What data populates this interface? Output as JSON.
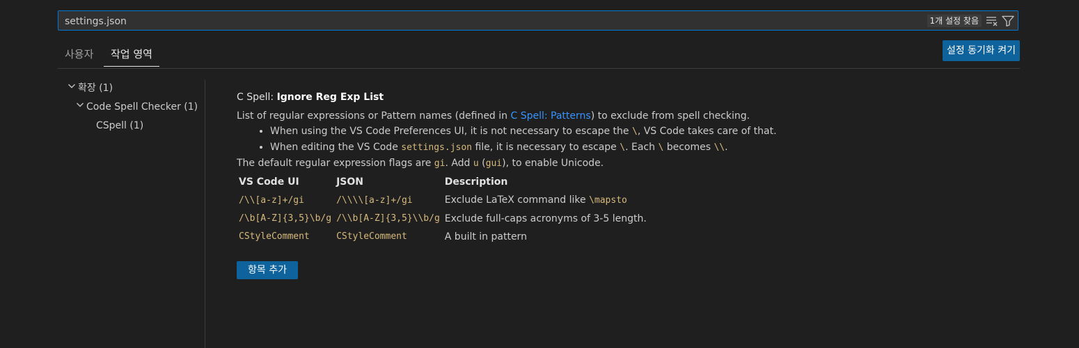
{
  "search": {
    "value": "settings.json",
    "result_count": "1개 설정 찾음",
    "clear_icon": "clear-filter-icon",
    "filter_icon": "filter-icon"
  },
  "tabs": [
    {
      "label": "사용자",
      "active": false
    },
    {
      "label": "작업 영역",
      "active": true
    }
  ],
  "sync_button": "설정 동기화 켜기",
  "tree": {
    "extensions": "확장 (1)",
    "code_spell_checker": "Code Spell Checker (1)",
    "cspell": "CSpell (1)"
  },
  "setting": {
    "category": "C Spell: ",
    "name": "Ignore Reg Exp List",
    "desc_pre": "List of regular expressions or Pattern names (defined in ",
    "desc_link": "C Spell: Patterns",
    "desc_post": ") to exclude from spell checking.",
    "bullet1_pre": "When using the VS Code Preferences UI, it is not necessary to escape the ",
    "bullet1_code": "\\",
    "bullet1_post": ", VS Code takes care of that.",
    "bullet2_a": "When editing the VS Code ",
    "bullet2_code1": "settings.json",
    "bullet2_b": " file, it is necessary to escape ",
    "bullet2_code2": "\\",
    "bullet2_c": ". Each ",
    "bullet2_code3": "\\",
    "bullet2_d": " becomes ",
    "bullet2_code4": "\\\\",
    "bullet2_e": ".",
    "flags_a": "The default regular expression flags are ",
    "flags_code1": "gi",
    "flags_b": ". Add ",
    "flags_code2": "u",
    "flags_c": " (",
    "flags_code3": "gui",
    "flags_d": "), to enable Unicode.",
    "table": {
      "headers": [
        "VS Code UI",
        "JSON",
        "Description"
      ],
      "rows": [
        {
          "ui": "/\\\\[a-z]+/gi",
          "json": "/\\\\\\\\[a-z]+/gi",
          "desc": "Exclude LaTeX command like ",
          "desc_code": "\\mapsto"
        },
        {
          "ui": "/\\b[A-Z]{3,5}\\b/g",
          "json": "/\\\\b[A-Z]{3,5}\\\\b/g",
          "desc": "Exclude full-caps acronyms of 3-5 length.",
          "desc_code": ""
        },
        {
          "ui": "CStyleComment",
          "json": "CStyleComment",
          "desc": "A built in pattern",
          "desc_code": ""
        }
      ]
    },
    "add_button": "항목 추가"
  }
}
